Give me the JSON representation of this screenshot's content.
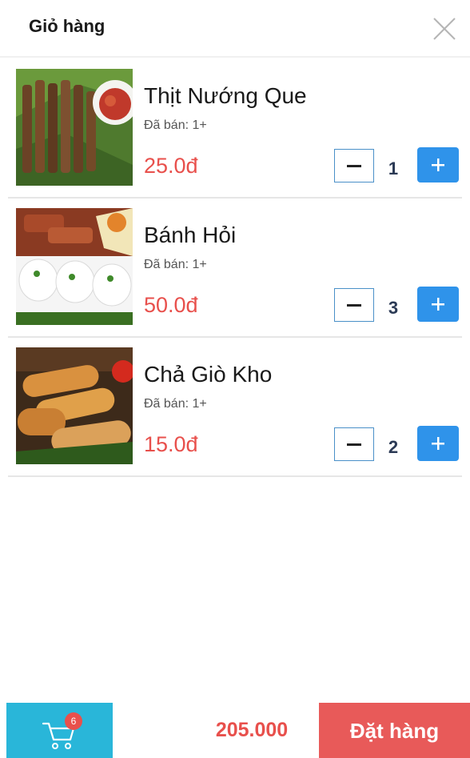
{
  "header": {
    "title": "Giỏ hàng",
    "close_icon": "close-icon"
  },
  "cart": {
    "items": [
      {
        "name": "Thịt Nướng Que",
        "sold": "Đã bán: 1+",
        "price": "25.0đ",
        "quantity": "1",
        "image": "grilled-pork-skewers"
      },
      {
        "name": "Bánh Hỏi",
        "sold": "Đã bán: 1+",
        "price": "50.0đ",
        "quantity": "3",
        "image": "rice-vermicelli-with-pork"
      },
      {
        "name": "Chả Giò Kho",
        "sold": "Đã bán: 1+",
        "price": "15.0đ",
        "quantity": "2",
        "image": "fried-spring-rolls"
      }
    ]
  },
  "footer": {
    "cart_icon": "shopping-cart-icon",
    "cart_badge": "6",
    "total": "205.000",
    "order_label": "Đặt hàng"
  },
  "colors": {
    "price_red": "#e8504c",
    "plus_blue": "#2f93ea",
    "cart_teal": "#29b6d9",
    "order_red": "#e85a59"
  }
}
